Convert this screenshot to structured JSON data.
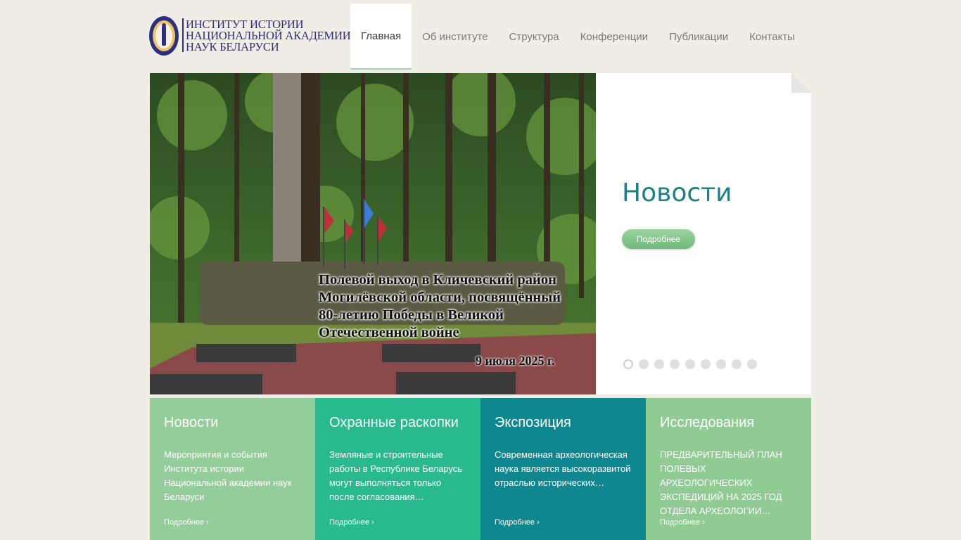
{
  "logo": {
    "lines": [
      "ИНСТИТУТ ИСТОРИИ",
      "НАЦИОНАЛЬНОЙ АКАДЕМИИ",
      "НАУК БЕЛАРУСИ"
    ],
    "icon": "institute-seal-icon"
  },
  "nav": [
    "Главная",
    "Об институте",
    "Структура",
    "Конференции",
    "Публикации",
    "Контакты"
  ],
  "hero": {
    "caption": [
      "Полевой выход в Кличевский район",
      "Могилёвской области, посвящённый",
      "80-летию Победы в Великой",
      "Отечественной войне"
    ],
    "date": "9 июля 2025 г."
  },
  "side": {
    "title": "Новости",
    "button": "Подробнее",
    "dots_count": 9
  },
  "tiles": [
    {
      "title": "Новости",
      "text": "Мероприятия и события Института истории Национальной академии наук Беларуси",
      "link": "Подробнее ›",
      "color": "#93cd99"
    },
    {
      "title": "Охранные раскопки",
      "text": "Земляные и строительные работы в Республике Беларусь могут выполняться только после согласования…",
      "link": "Подробнее ›",
      "color": "#28b98f"
    },
    {
      "title": "Экспозиция",
      "text": "Современная археологическая наука является высокоразвитой отраслью исторических…",
      "link": "Подробнее ›",
      "color": "#0f878f"
    },
    {
      "title": "Исследования",
      "text": "ПРЕДВАРИТЕЛЬНЫЙ ПЛАН ПОЛЕВЫХ АРХЕОЛОГИЧЕСКИХ ЭКСПЕДИЦИЙ НА 2025 ГОД ОТДЕЛА АРХЕОЛОГИИ…",
      "link": "Подробнее ›",
      "color": "#8fcb93"
    }
  ]
}
